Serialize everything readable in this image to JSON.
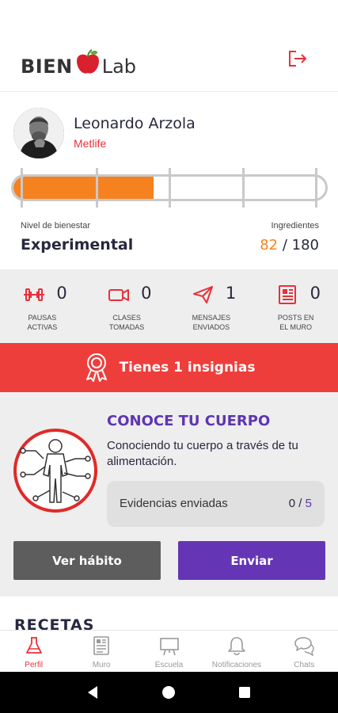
{
  "header": {
    "logo_left": "BIEN",
    "logo_right": "Lab",
    "logout_icon": "logout-icon"
  },
  "profile": {
    "name": "Leonardo Arzola",
    "company": "Metlife",
    "progress_fraction": 0.45,
    "level_label": "Nivel de bienestar",
    "level_value": "Experimental",
    "ingredients_label": "Ingredientes",
    "ingredients_current": "82",
    "ingredients_separator": " / ",
    "ingredients_total": "180"
  },
  "stats": [
    {
      "icon": "dumbbell-icon",
      "count": "0",
      "label": "PAUSAS\nACTIVAS"
    },
    {
      "icon": "video-camera-icon",
      "count": "0",
      "label": "CLASES\nTOMADAS"
    },
    {
      "icon": "paper-plane-icon",
      "count": "1",
      "label": "MENSAJES\nENVIADOS"
    },
    {
      "icon": "newspaper-icon",
      "count": "0",
      "label": "POSTS EN\nEL MURO"
    }
  ],
  "badges": {
    "text": "Tienes 1 insignias",
    "icon": "award-ribbon-icon"
  },
  "habit": {
    "title": "CONOCE TU CUERPO",
    "description": "Conociendo tu cuerpo a través de tu alimentación.",
    "evidence_label": "Evidencias enviadas",
    "evidence_sent": "0",
    "evidence_separator": " / ",
    "evidence_total": "5",
    "btn_view": "Ver hábito",
    "btn_send": "Enviar"
  },
  "recipes": {
    "title": "RECETAS"
  },
  "bottom_nav": [
    {
      "label": "Perfil",
      "icon": "flask-icon",
      "active": true
    },
    {
      "label": "Muro",
      "icon": "newspaper-icon",
      "active": false
    },
    {
      "label": "Escuela",
      "icon": "easel-icon",
      "active": false
    },
    {
      "label": "Notificaciones",
      "icon": "bell-icon",
      "active": false
    },
    {
      "label": "Chats",
      "icon": "chat-bubbles-icon",
      "active": false
    }
  ],
  "colors": {
    "brand_red": "#e8303a",
    "progress_orange": "#f5821f",
    "accent_purple": "#6436b5",
    "badge_red": "#ee3e3b"
  }
}
